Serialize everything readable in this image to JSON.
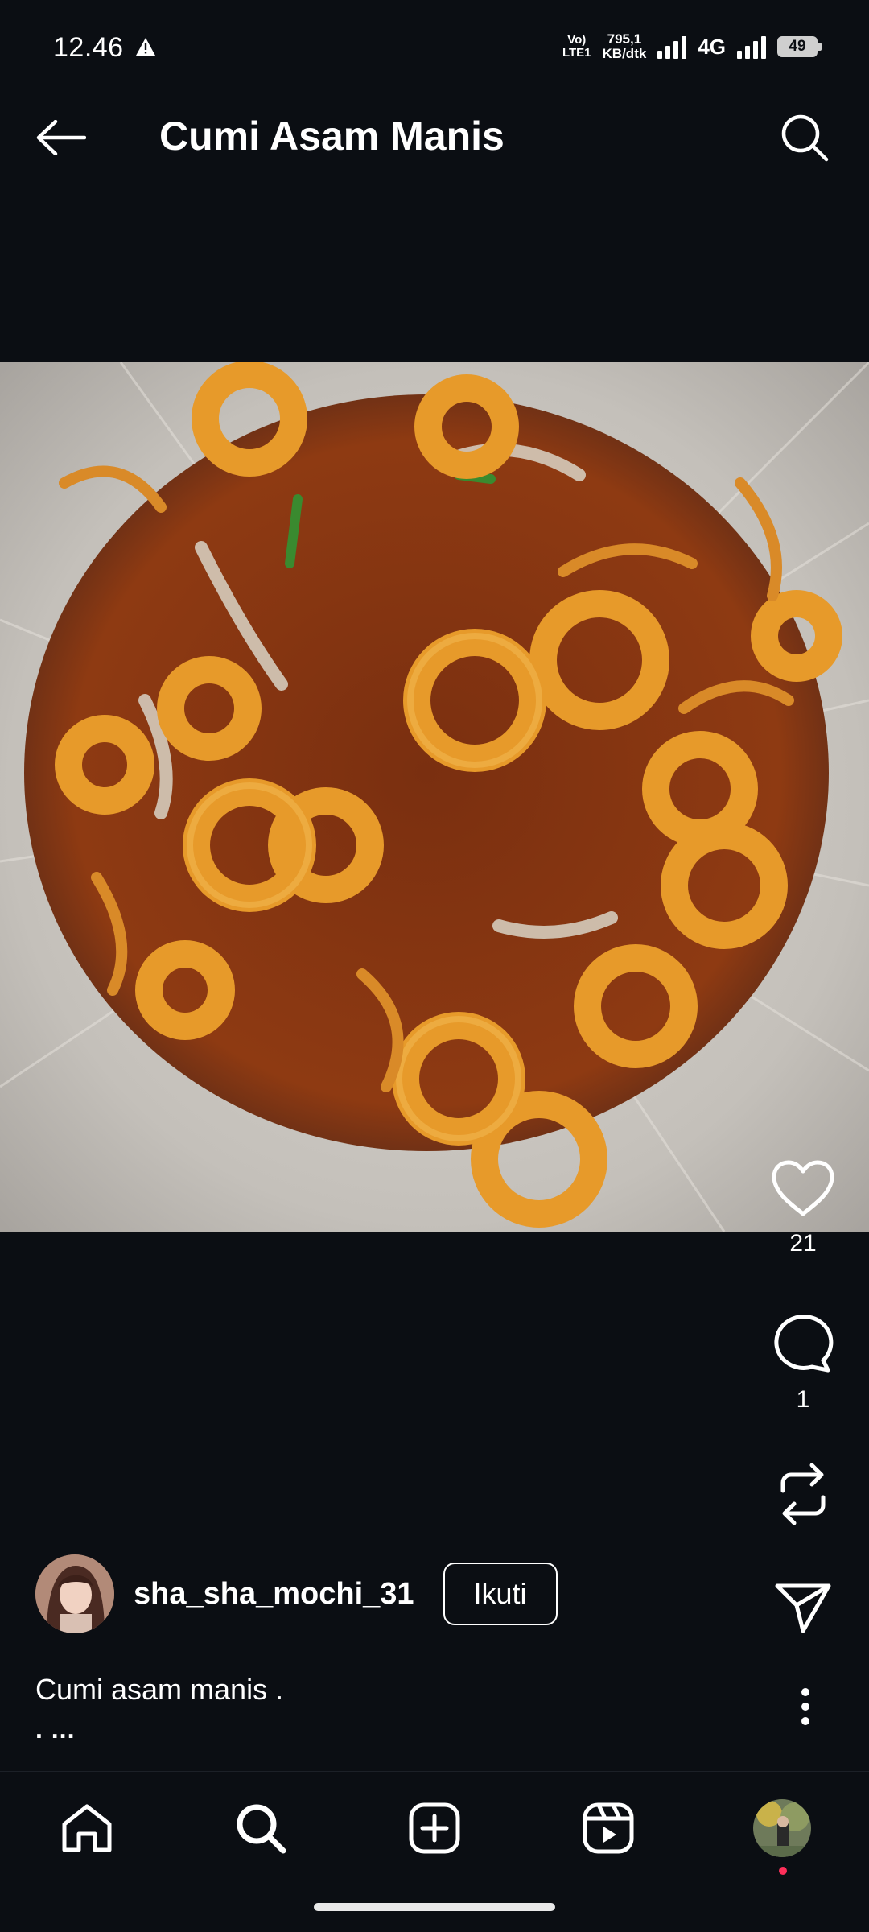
{
  "status_bar": {
    "time": "12.46",
    "volte_line1": "Vo)",
    "volte_line2": "LTE1",
    "speed_value": "795,1",
    "speed_unit": "KB/dtk",
    "network": "4G",
    "battery": "49"
  },
  "header": {
    "title": "Cumi Asam Manis",
    "back_icon": "arrow-left-icon",
    "search_icon": "search-icon"
  },
  "post": {
    "image_subject": "squid in sweet and sour sauce",
    "likes": "21",
    "comments": "1",
    "author": "sha_sha_mochi_31",
    "follow_label": "Ikuti",
    "caption": "Cumi asam manis .",
    "caption_more": ". ..."
  },
  "nav": {
    "items": [
      "home-icon",
      "search-icon",
      "create-icon",
      "reels-icon",
      "profile-avatar"
    ]
  },
  "colors": {
    "background": "#0b0e13",
    "text": "#ffffff",
    "notification_dot": "#ff2f5a"
  }
}
